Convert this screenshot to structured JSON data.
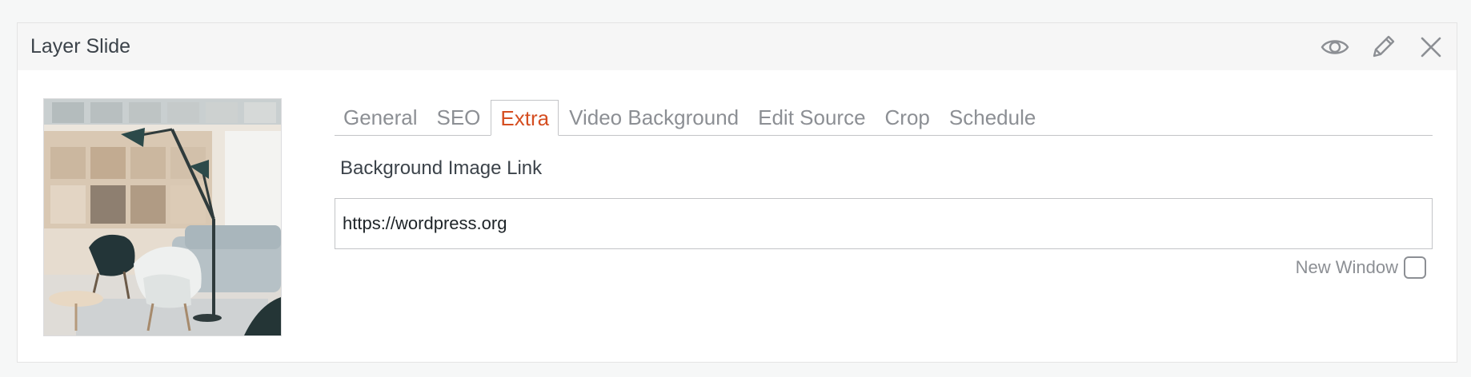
{
  "panel": {
    "title": "Layer Slide",
    "actions": [
      {
        "icon": "eye-icon"
      },
      {
        "icon": "pencil-icon"
      },
      {
        "icon": "close-icon"
      }
    ]
  },
  "thumbnail": {
    "icon": "slide-image-thumbnail"
  },
  "tabs": [
    {
      "label": "General",
      "active": false
    },
    {
      "label": "SEO",
      "active": false
    },
    {
      "label": "Extra",
      "active": true
    },
    {
      "label": "Video Background",
      "active": false
    },
    {
      "label": "Edit Source",
      "active": false
    },
    {
      "label": "Crop",
      "active": false
    },
    {
      "label": "Schedule",
      "active": false
    }
  ],
  "extra": {
    "background_link_label": "Background Image Link",
    "background_link_value": "https://wordpress.org",
    "new_window_label": "New Window",
    "new_window_checked": false
  },
  "colors": {
    "active_tab": "#d54e21",
    "muted_text": "#8c8f94",
    "border": "#c3c4c7"
  }
}
